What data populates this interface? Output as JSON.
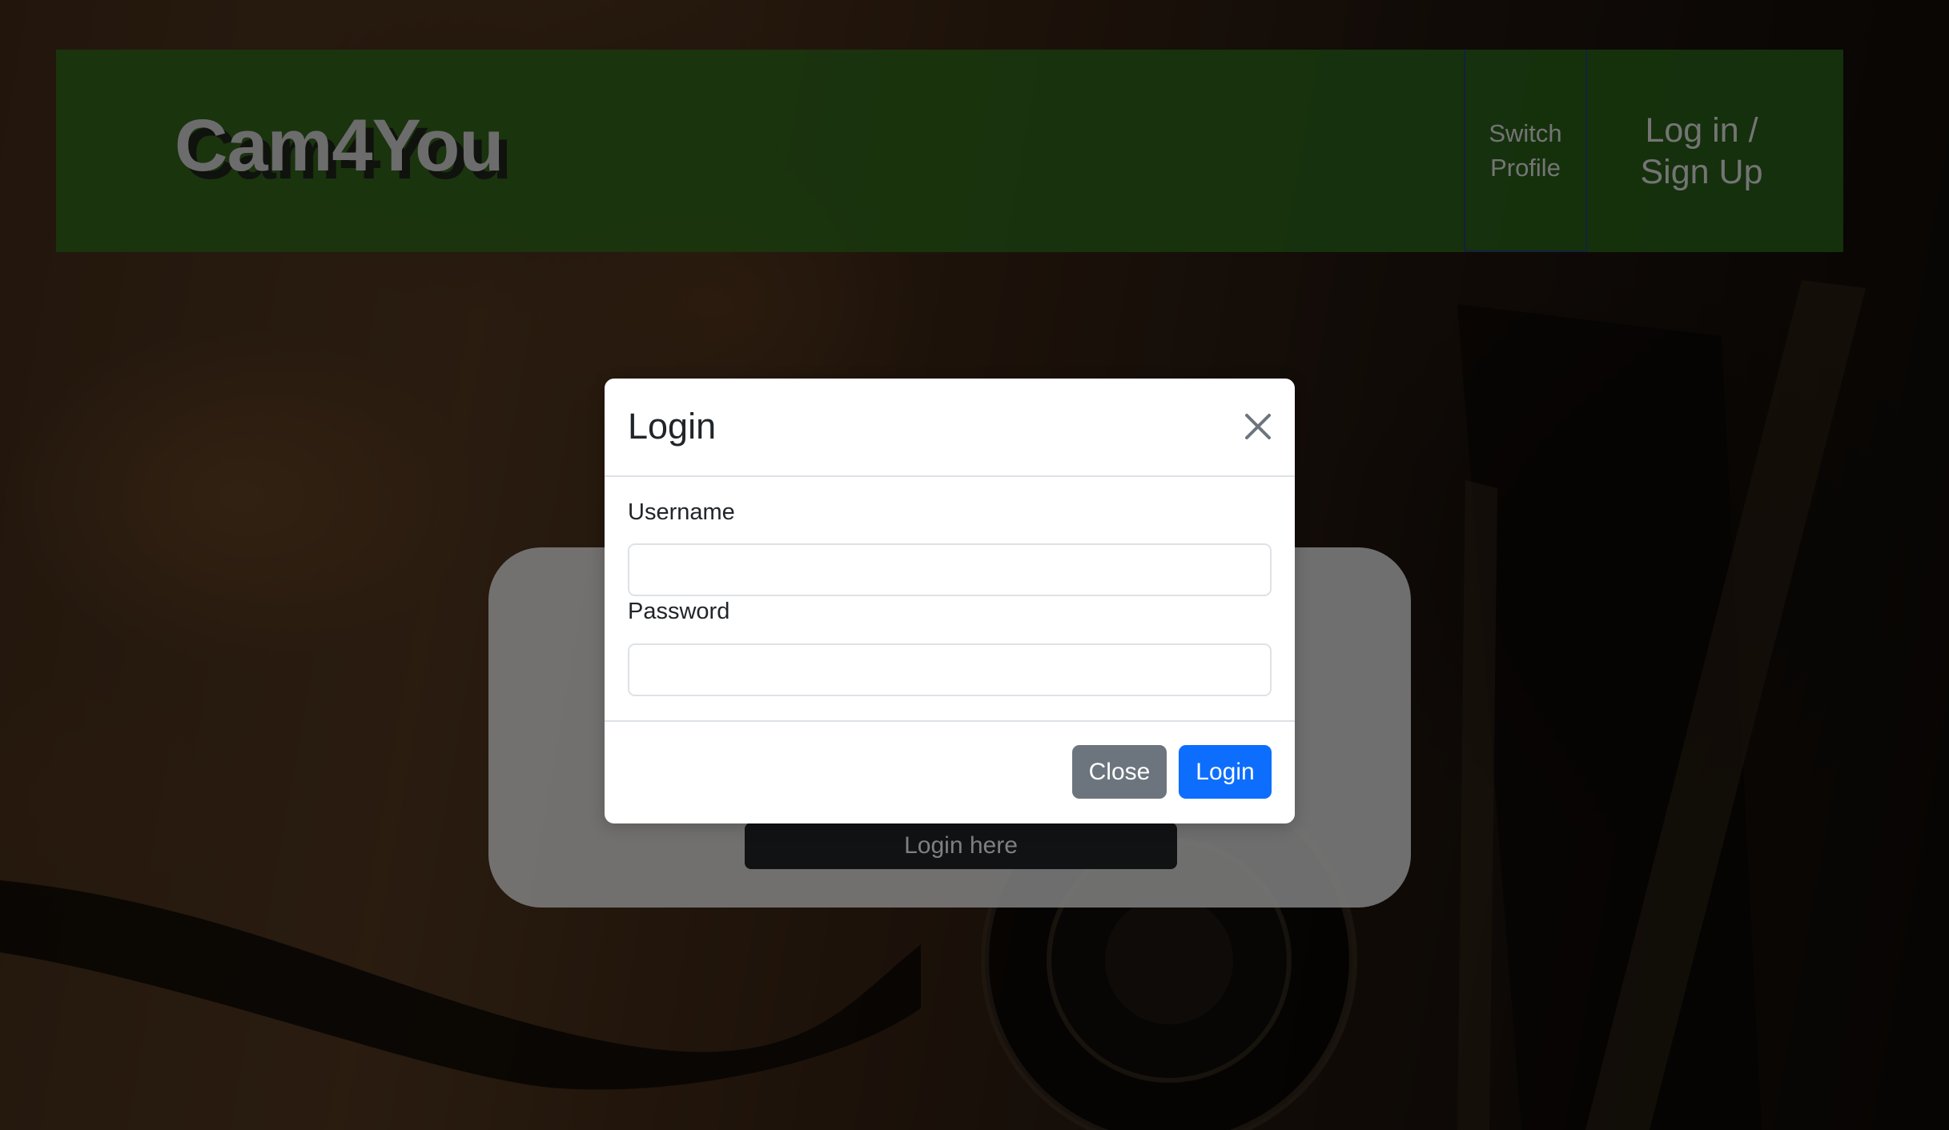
{
  "navbar": {
    "brand": "Cam4You",
    "switch_profile": "Switch Profile",
    "login_signup": "Log in / Sign Up",
    "bg_color": "#30781e"
  },
  "card": {
    "button_label": "Login here"
  },
  "modal": {
    "title": "Login",
    "close_icon": "close-icon",
    "username_label": "Username",
    "username_value": "",
    "password_label": "Password",
    "password_value": "",
    "close_button": "Close",
    "login_button": "Login",
    "primary_color": "#0d6efd",
    "secondary_color": "#6c757d"
  }
}
